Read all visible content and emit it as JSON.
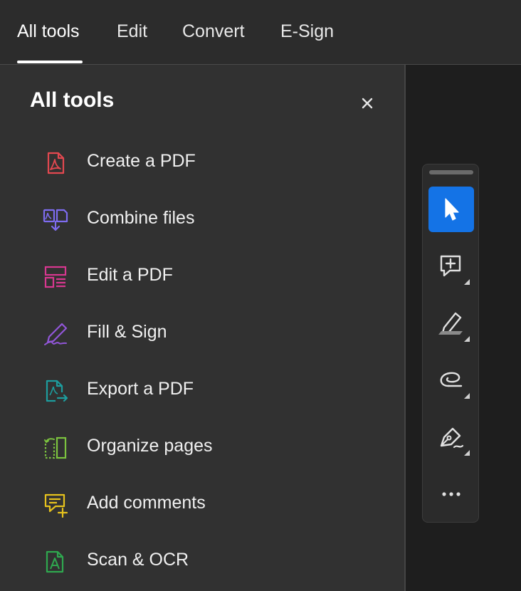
{
  "tabs": [
    {
      "label": "All tools",
      "active": true
    },
    {
      "label": "Edit",
      "active": false
    },
    {
      "label": "Convert",
      "active": false
    },
    {
      "label": "E-Sign",
      "active": false
    }
  ],
  "panel": {
    "title": "All tools",
    "close_icon": "close-icon",
    "tools": [
      {
        "label": "Create a PDF",
        "icon": "create-pdf-icon",
        "color": "#e34850"
      },
      {
        "label": "Combine files",
        "icon": "combine-files-icon",
        "color": "#7e6cf0"
      },
      {
        "label": "Edit a PDF",
        "icon": "edit-pdf-icon",
        "color": "#d83790"
      },
      {
        "label": "Fill & Sign",
        "icon": "fill-sign-icon",
        "color": "#9256d9"
      },
      {
        "label": "Export a PDF",
        "icon": "export-pdf-icon",
        "color": "#1d9d9e"
      },
      {
        "label": "Organize pages",
        "icon": "organize-pages-icon",
        "color": "#7cc33f"
      },
      {
        "label": "Add comments",
        "icon": "add-comments-icon",
        "color": "#e6c21d"
      },
      {
        "label": "Scan & OCR",
        "icon": "scan-ocr-icon",
        "color": "#2fa84f"
      }
    ]
  },
  "floating_toolbar": {
    "accent": "#1473e6",
    "buttons": [
      {
        "icon": "select-cursor-icon",
        "active": true
      },
      {
        "icon": "add-comment-icon",
        "active": false
      },
      {
        "icon": "highlight-icon",
        "active": false
      },
      {
        "icon": "draw-freeform-icon",
        "active": false
      },
      {
        "icon": "pen-sign-icon",
        "active": false
      },
      {
        "icon": "more-options-icon",
        "active": false
      }
    ]
  }
}
